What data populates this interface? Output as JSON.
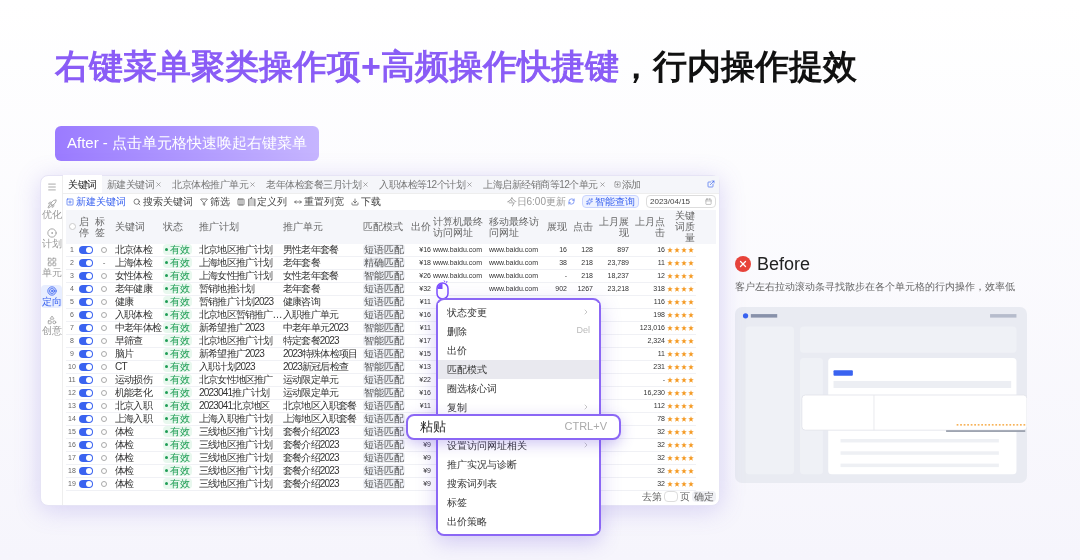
{
  "headline": {
    "highlight": "右键菜单聚类操作项+高频操作快捷键",
    "rest": "，行内操作提效"
  },
  "after_badge": "After - 点击单元格快速唤起右键菜单",
  "app": {
    "sidebar": [
      {
        "label": "优化",
        "selected": false
      },
      {
        "label": "计划",
        "selected": false
      },
      {
        "label": "单元",
        "selected": false
      },
      {
        "label": "定向",
        "selected": true
      },
      {
        "label": "创意",
        "selected": false
      }
    ],
    "tabs": [
      {
        "label": "关键词",
        "selected": true,
        "closable": false
      },
      {
        "label": "新建关键词",
        "selected": false,
        "closable": true
      },
      {
        "label": "北京体检推广单元",
        "selected": false,
        "closable": true
      },
      {
        "label": "老年体检套餐三月计划",
        "selected": false,
        "closable": true
      },
      {
        "label": "入职体检等12个计划",
        "selected": false,
        "closable": true
      },
      {
        "label": "上海启新经销商等12个单元",
        "selected": false,
        "closable": true
      }
    ],
    "add_tab": "添加",
    "toolbar": [
      {
        "label": "新建关键词",
        "kind": "create"
      },
      {
        "label": "搜索关键词",
        "kind": "search"
      },
      {
        "label": "筛选",
        "kind": "filter"
      },
      {
        "label": "自定义列",
        "kind": "columns"
      },
      {
        "label": "重置列宽",
        "kind": "reset"
      },
      {
        "label": "下载",
        "kind": "download"
      }
    ],
    "update_note": "今日6:00更新",
    "smart_query": "智能查询",
    "date": "2023/04/15",
    "header_checkbox": {
      "checked": false
    },
    "columns": [
      "启停",
      "标签",
      "关键词",
      "状态",
      "推广计划",
      "推广单元",
      "匹配模式",
      "出价",
      "计算机最终访问网址",
      "移动最终访问网址",
      "展现",
      "点击",
      "上月展现",
      "上月点击",
      "关键词质量"
    ],
    "rows": [
      {
        "no": "1",
        "on": true,
        "tag": {
          "kind": "icon"
        },
        "keyword": "北京体检",
        "status": "有效",
        "plan": "北京地区推广计划",
        "unit": "男性老年套餐",
        "match": "短语匹配",
        "bid": "¥16",
        "pc_url": "www.baidu.com",
        "mobile_url": "www.baidu.com",
        "impressions": "16",
        "clicks": "128",
        "last_impressions": "897",
        "last_clicks": "16",
        "stars": 4
      },
      {
        "no": "2",
        "on": true,
        "tag": {
          "kind": "text",
          "text": "-"
        },
        "keyword": "上海体检",
        "status": "有效",
        "plan": "上海地区推广计划",
        "unit": "老年套餐",
        "match": "精确匹配",
        "bid": "¥18",
        "pc_url": "www.baidu.com",
        "mobile_url": "www.baidu.com",
        "impressions": "38",
        "clicks": "218",
        "last_impressions": "23,789",
        "last_clicks": "11",
        "stars": 4
      },
      {
        "no": "3",
        "on": true,
        "tag": {
          "kind": "icon"
        },
        "keyword": "女性体检",
        "status": "有效",
        "plan": "上海女性推广计划",
        "unit": "女性老年套餐",
        "match": "智能匹配",
        "bid": "¥26",
        "pc_url": "www.baidu.com",
        "mobile_url": "www.baidu.com",
        "impressions": "-",
        "clicks": "218",
        "last_impressions": "18,237",
        "last_clicks": "12",
        "stars": 4
      },
      {
        "no": "4",
        "on": true,
        "tag": {
          "kind": "icon"
        },
        "keyword": "老年健康",
        "status": "有效",
        "plan": "暂销地推计划",
        "unit": "老年套餐",
        "match": "短语匹配",
        "bid": "¥32",
        "mobile_url": "www.baidu.com",
        "impressions": "902",
        "clicks": "1267",
        "last_impressions": "23,218",
        "last_clicks": "318",
        "stars": 4
      },
      {
        "no": "5",
        "on": true,
        "tag": {
          "kind": "icon"
        },
        "keyword": "健康",
        "status": "有效",
        "plan": "暂销推广计划2023",
        "unit": "健康咨询",
        "match": "短语匹配",
        "bid": "¥11",
        "last_clicks": "116",
        "stars": 4
      },
      {
        "no": "6",
        "on": true,
        "tag": {
          "kind": "icon"
        },
        "keyword": "入职体检",
        "status": "有效",
        "plan": "北京地区暂销推广…",
        "unit": "入职推广单元",
        "match": "短语匹配",
        "bid": "¥16",
        "last_clicks": "198",
        "stars": 4
      },
      {
        "no": "7",
        "on": true,
        "tag": {
          "kind": "icon"
        },
        "keyword": "中老年体检",
        "status": "有效",
        "plan": "新希望推广2023",
        "unit": "中老年单元2023",
        "match": "智能匹配",
        "bid": "¥11",
        "last_clicks": "123,016",
        "stars": 4
      },
      {
        "no": "8",
        "on": true,
        "tag": {
          "kind": "icon"
        },
        "keyword": "早筛查",
        "status": "有效",
        "plan": "北京地区推广计划",
        "unit": "特定套餐2023",
        "match": "智能匹配",
        "bid": "¥17",
        "last_clicks": "2,324",
        "stars": 4
      },
      {
        "no": "9",
        "on": true,
        "tag": {
          "kind": "icon"
        },
        "keyword": "脑片",
        "status": "有效",
        "plan": "新希望推广2023",
        "unit": "2023特殊体检项目",
        "match": "短语匹配",
        "bid": "¥15",
        "last_clicks": "11",
        "stars": 4
      },
      {
        "no": "10",
        "on": true,
        "tag": {
          "kind": "icon"
        },
        "keyword": "CT",
        "status": "有效",
        "plan": "入职计划2023",
        "unit": "2023新冠后检查",
        "match": "智能匹配",
        "bid": "¥13",
        "last_clicks": "231",
        "stars": 4
      },
      {
        "no": "11",
        "on": true,
        "tag": {
          "kind": "icon"
        },
        "keyword": "运动损伤",
        "status": "有效",
        "plan": "北京女性地区推广",
        "unit": "运动限定单元",
        "match": "短语匹配",
        "bid": "¥22",
        "last_clicks": "-",
        "stars": 4
      },
      {
        "no": "12",
        "on": true,
        "tag": {
          "kind": "icon"
        },
        "keyword": "机能老化",
        "status": "有效",
        "plan": "2023041推广计划",
        "unit": "运动限定单元",
        "match": "智能匹配",
        "bid": "¥16",
        "last_clicks": "16,230",
        "stars": 4
      },
      {
        "no": "13",
        "on": true,
        "tag": {
          "kind": "icon"
        },
        "keyword": "北京入职",
        "status": "有效",
        "plan": "2023041北京地区",
        "unit": "北京地区入职套餐",
        "match": "短语匹配",
        "bid": "¥11",
        "last_clicks": "112",
        "stars": 4
      },
      {
        "no": "14",
        "on": true,
        "tag": {
          "kind": "icon"
        },
        "keyword": "上海入职",
        "status": "有效",
        "plan": "上海入职推广计划",
        "unit": "上海地区入职套餐",
        "match": "短语匹配",
        "last_clicks": "78",
        "stars": 4
      },
      {
        "no": "15",
        "on": true,
        "tag": {
          "kind": "icon"
        },
        "keyword": "体检",
        "status": "有效",
        "plan": "三线地区推广计划",
        "unit": "套餐介绍2023",
        "match": "短语匹配",
        "last_clicks": "32",
        "stars": 4
      },
      {
        "no": "16",
        "on": true,
        "tag": {
          "kind": "icon"
        },
        "keyword": "体检",
        "status": "有效",
        "plan": "三线地区推广计划",
        "unit": "套餐介绍2023",
        "match": "短语匹配",
        "bid": "¥9",
        "last_clicks": "32",
        "stars": 4
      },
      {
        "no": "17",
        "on": true,
        "tag": {
          "kind": "icon"
        },
        "keyword": "体检",
        "status": "有效",
        "plan": "三线地区推广计划",
        "unit": "套餐介绍2023",
        "match": "短语匹配",
        "bid": "¥9",
        "last_clicks": "32",
        "stars": 4
      },
      {
        "no": "18",
        "on": true,
        "tag": {
          "kind": "icon"
        },
        "keyword": "体检",
        "status": "有效",
        "plan": "三线地区推广计划",
        "unit": "套餐介绍2023",
        "match": "短语匹配",
        "bid": "¥9",
        "last_clicks": "32",
        "stars": 4
      },
      {
        "no": "19",
        "on": true,
        "tag": {
          "kind": "icon"
        },
        "keyword": "体检",
        "status": "有效",
        "plan": "三线地区推广计划",
        "unit": "套餐介绍2023",
        "match": "短语匹配",
        "bid": "¥9",
        "last_clicks": "32",
        "stars": 4
      }
    ],
    "pagination": {
      "goto": "去第",
      "page": "页",
      "confirm": "确定"
    }
  },
  "menu": {
    "items": [
      {
        "label": "状态变更",
        "kind": "item",
        "submenu": true,
        "hovered": false
      },
      {
        "label": "删除",
        "kind": "item",
        "shortcut": "Del",
        "submenu": false,
        "hovered": false
      },
      {
        "label": "出价",
        "kind": "item",
        "submenu": false,
        "hovered": false
      },
      {
        "label": "匹配模式",
        "kind": "item",
        "submenu": false,
        "hovered": true
      },
      {
        "label": "圈选核心词",
        "kind": "item",
        "submenu": false,
        "hovered": false
      },
      {
        "label": "复制",
        "kind": "item",
        "submenu": true,
        "hovered": false
      },
      {
        "label": "粘贴",
        "kind": "popout",
        "shortcut": "CTRL+V"
      },
      {
        "label": "设置访问网址相关",
        "kind": "item",
        "submenu": true,
        "hovered": false
      },
      {
        "label": "推广实况与诊断",
        "kind": "item",
        "submenu": false,
        "hovered": false
      },
      {
        "label": "搜索词列表",
        "kind": "item",
        "submenu": false,
        "hovered": false
      },
      {
        "label": "标签",
        "kind": "item",
        "submenu": false,
        "hovered": false
      },
      {
        "label": "出价策略",
        "kind": "item",
        "submenu": false,
        "hovered": false
      }
    ]
  },
  "before": {
    "label": "Before",
    "note": "客户左右拉动滚动条寻找散步在各个单元格的行内操作，效率低"
  }
}
